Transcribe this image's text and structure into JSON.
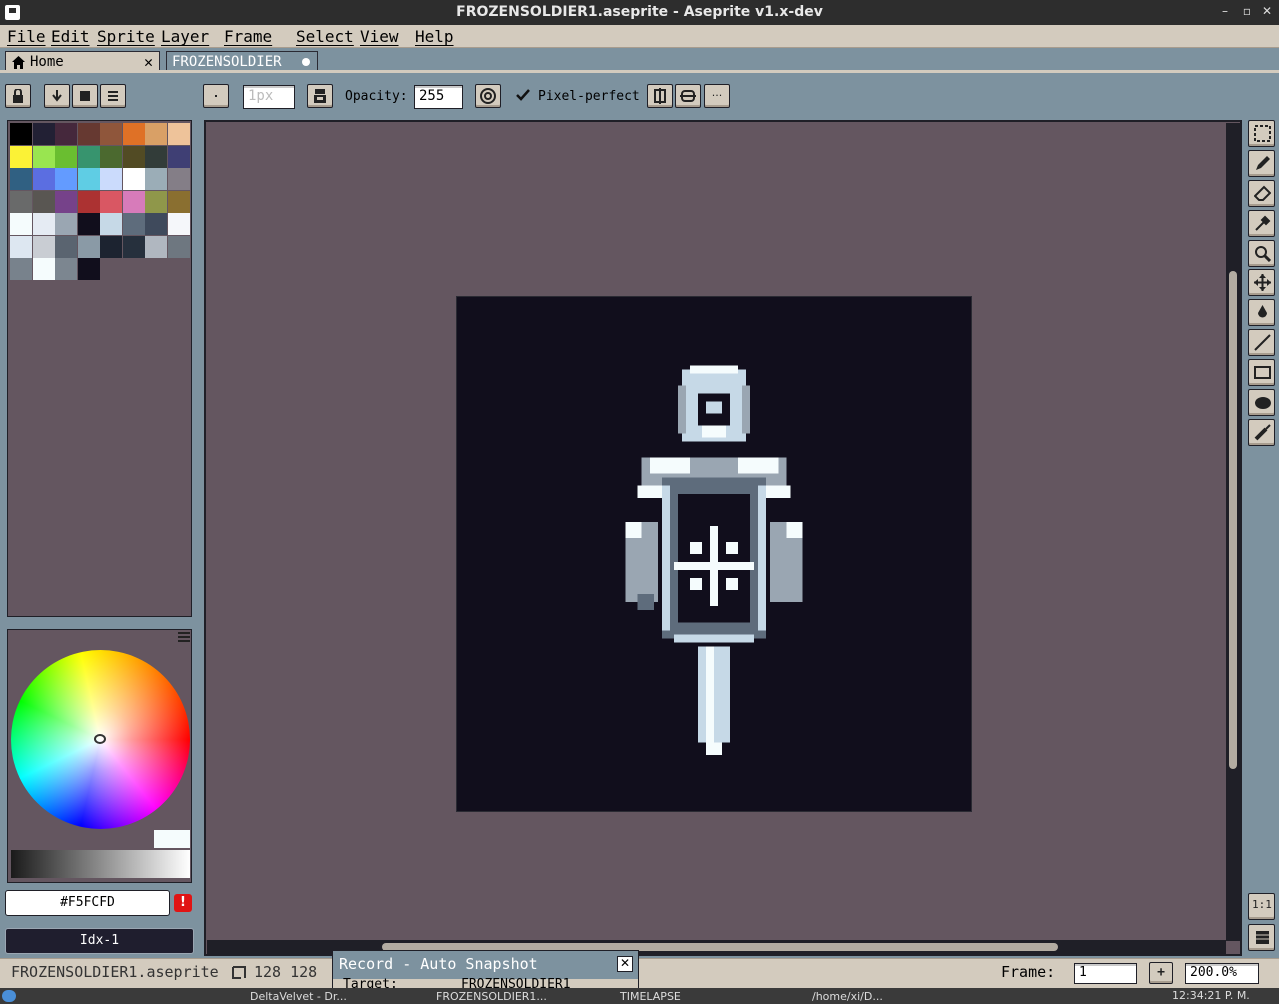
{
  "window": {
    "title": "FROZENSOLDIER1.aseprite - Aseprite v1.x-dev",
    "btn_min": "–",
    "btn_max": "▫",
    "btn_close": "✕"
  },
  "menu": [
    "File",
    "Edit",
    "Sprite",
    "Layer",
    "Frame",
    "Select",
    "View",
    "Help"
  ],
  "tabs": {
    "home": "Home",
    "home_close": "✕",
    "active": "FROZENSOLDIER"
  },
  "toolbar": {
    "brush_size": "1px",
    "opacity_label": "Opacity:",
    "opacity_value": "255",
    "pixel_perfect_label": "Pixel-perfect",
    "pixel_perfect_checked": true,
    "more_label": "···"
  },
  "palette": {
    "colors": [
      "#000000",
      "#222034",
      "#45283c",
      "#663931",
      "#8f563b",
      "#df7126",
      "#d9a066",
      "#eec39a",
      "#fbf236",
      "#99e550",
      "#6abe30",
      "#37946e",
      "#4b692f",
      "#524b24",
      "#323c39",
      "#3f3f74",
      "#306082",
      "#5b6ee1",
      "#639bff",
      "#5fcde4",
      "#cbdbfc",
      "#ffffff",
      "#9badb7",
      "#847e87",
      "#696a6a",
      "#595652",
      "#76428a",
      "#ac3232",
      "#d95763",
      "#d77bba",
      "#8f974a",
      "#8a6f30",
      "#f5fcfd",
      "#e5ebf3",
      "#9aa6b2",
      "#110e1c",
      "#c6d9e7",
      "#5e6c7c",
      "#3f4a5c",
      "#f5f7fa",
      "#dde7f1",
      "#c9cdd3",
      "#5a6470",
      "#8a9aa6",
      "#1c2330",
      "#26303d",
      "#b0b7c0",
      "#6e7780",
      "#78828c",
      "#f5fcfd",
      "#7c8690",
      "#110e1c"
    ]
  },
  "color": {
    "hex": "#F5FCFD",
    "warning": "!",
    "index": "Idx-1"
  },
  "status": {
    "filename": "FROZENSOLDIER1.aseprite",
    "size": "128 128",
    "frame_label": "Frame:",
    "frame_value": "1",
    "add": "+",
    "zoom": "200.0%"
  },
  "record": {
    "title": "Record - Auto Snapshot",
    "close": "✕",
    "target_label": "Target:",
    "target_value": "FROZENSOLDIER1"
  },
  "taskbar": {
    "items": [
      "DeltaVelvet - Dr...",
      "FROZENSOLDIER1...",
      "TIMELAPSE",
      "/home/xi/D..."
    ],
    "clock": "12:34:21 P. M."
  }
}
